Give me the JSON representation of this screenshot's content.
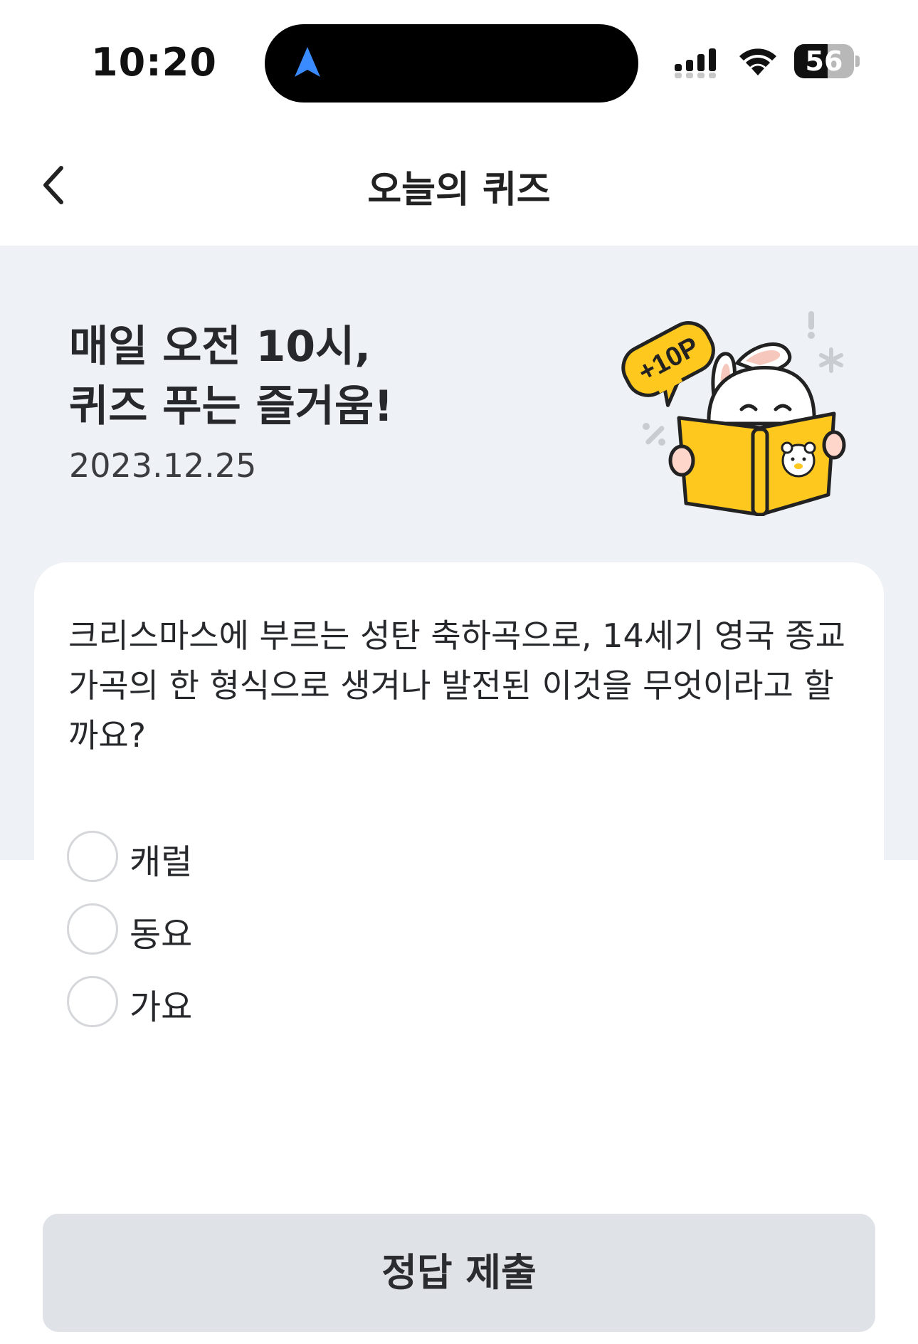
{
  "status_bar": {
    "time": "10:20",
    "battery_level": "56",
    "battery_percent": 56
  },
  "nav": {
    "title": "오늘의 퀴즈"
  },
  "hero": {
    "title_line1": "매일 오전 10시,",
    "title_line2": "퀴즈 푸는 즐거움!",
    "date": "2023.12.25",
    "badge": "+10P"
  },
  "quiz": {
    "question": "크리스마스에 부르는 성탄 축하곡으로, 14세기 영국 종교 가곡의 한 형식으로 생겨나 발전된 이것을 무엇이라고 할까요?",
    "options": [
      "캐럴",
      "동요",
      "가요"
    ]
  },
  "submit": {
    "label": "정답 제출"
  },
  "colors": {
    "hero_bg": "#eef1f5",
    "button_bg": "#dfe2e6",
    "book_yellow": "#ffc81e",
    "location_blue": "#3a8bff"
  }
}
